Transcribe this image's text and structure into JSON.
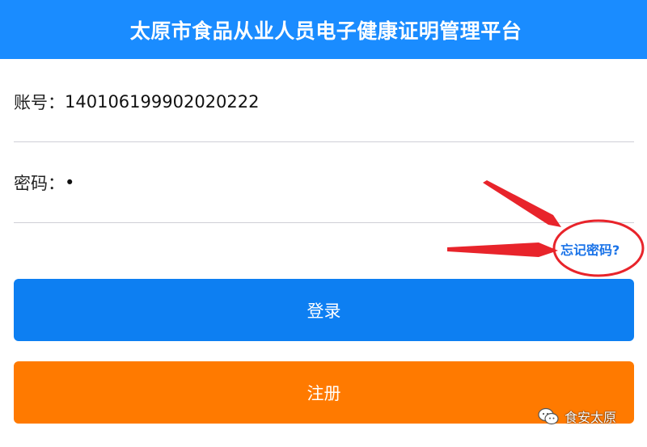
{
  "header": {
    "title": "太原市食品从业人员电子健康证明管理平台"
  },
  "form": {
    "account_label": "账号：",
    "account_value": "140106199902020222",
    "password_label": "密码：",
    "password_value": "•"
  },
  "links": {
    "forgot_password": "忘记密码?"
  },
  "buttons": {
    "login": "登录",
    "register": "注册"
  },
  "watermark": {
    "text": "食安太原"
  },
  "colors": {
    "header_bg": "#1a8cff",
    "login_bg": "#0d7ff2",
    "register_bg": "#ff7a00",
    "link": "#1a73e8",
    "annotation": "#e8242b"
  }
}
